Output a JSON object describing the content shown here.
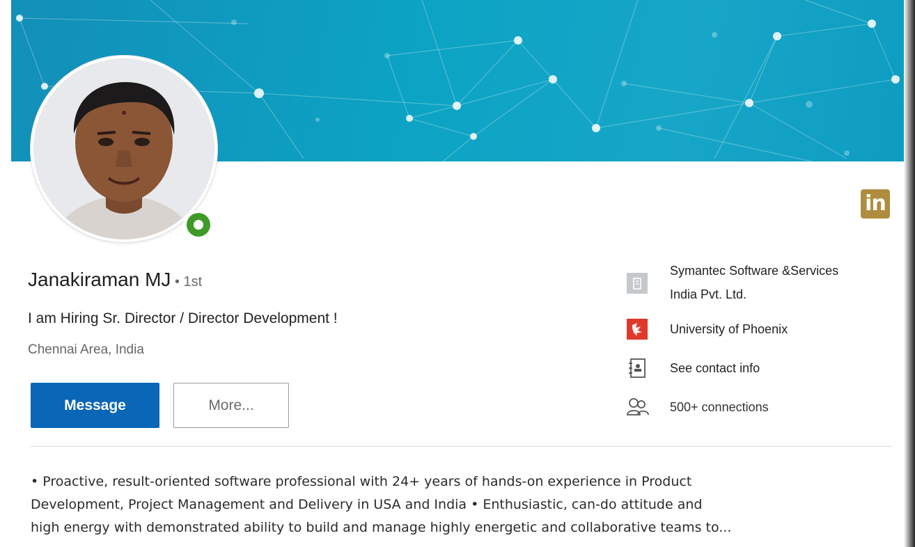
{
  "profile": {
    "name": "Janakiraman MJ",
    "degree": " • 1st",
    "headline": "I am Hiring Sr. Director / Director Development !",
    "location": "Chennai Area, India"
  },
  "actions": {
    "message_label": "Message",
    "more_label": "More..."
  },
  "brand": {
    "logo_text": "in",
    "logo_color": "#b08d3e"
  },
  "side": {
    "company_line1": "Symantec Software &Services",
    "company_line2": "India Pvt. Ltd.",
    "school": "University of Phoenix",
    "contact": "See contact info",
    "connections": "500+ connections"
  },
  "icons": {
    "company": "building-icon",
    "school": "school-logo-icon",
    "contact": "address-book-icon",
    "connections": "people-icon",
    "presence": "online-status-icon"
  },
  "summary": {
    "line1": "• Proactive, result-oriented software professional with 24+ years of hands-on experience in Product",
    "line2": "Development, Project Management and Delivery in USA and India • Enthusiastic, can-do attitude and",
    "line3": "high energy with demonstrated ability to build and manage highly energetic and collaborative teams to..."
  },
  "colors": {
    "banner": "#0ca3c4",
    "primary_button": "#0a66b7",
    "presence": "#3f9a28",
    "school_logo": "#e0382b"
  }
}
